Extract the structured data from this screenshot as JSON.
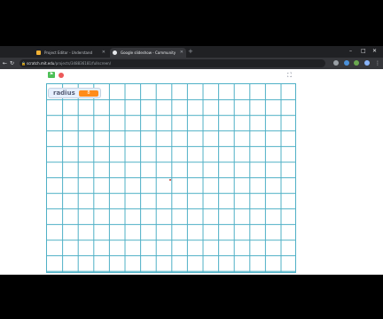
{
  "browser": {
    "tabs": [
      {
        "label": "Project Editor - Understand",
        "active": false
      },
      {
        "label": "Project Editor - Understand",
        "active": true
      },
      {
        "label": "Google slideshow - Community",
        "active": false
      }
    ],
    "new_tab_label": "+",
    "url_host": "scratch.mit.edu",
    "url_path": "/projects/348836181/fullscreen/"
  },
  "controls": {
    "green_flag": "⚑",
    "fullscreen": "⛶"
  },
  "monitor": {
    "label": "radius",
    "value": "8"
  },
  "colors": {
    "grid": "#4fb0c6",
    "monitor_value_bg": "#ff8c1a",
    "flag": "#4cbf56",
    "stop": "#ec5959"
  }
}
